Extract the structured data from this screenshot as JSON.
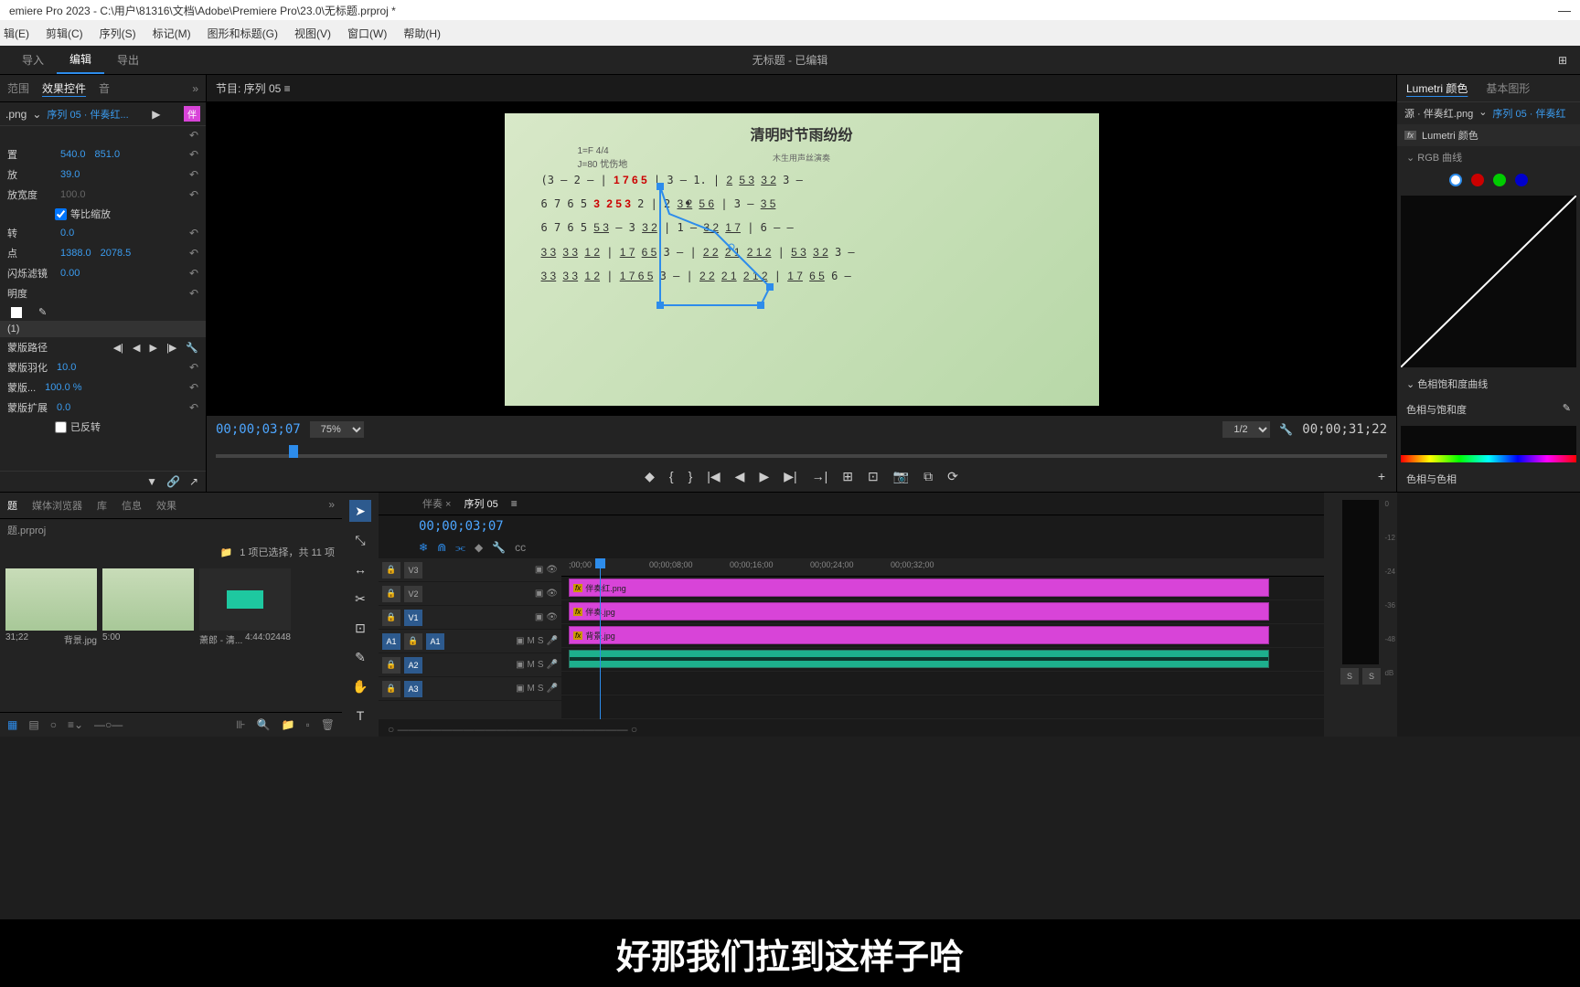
{
  "titlebar": {
    "title": "emiere Pro 2023 - C:\\用户\\81316\\文档\\Adobe\\Premiere Pro\\23.0\\无标题.prproj *"
  },
  "menubar": {
    "items": [
      "辑(E)",
      "剪辑(C)",
      "序列(S)",
      "标记(M)",
      "图形和标题(G)",
      "视图(V)",
      "窗口(W)",
      "帮助(H)"
    ]
  },
  "workspace": {
    "tabs": [
      "导入",
      "编辑",
      "导出"
    ],
    "active": 1,
    "center": "无标题 - 已编辑"
  },
  "effects_panel": {
    "tabs": [
      "范围",
      "效果控件",
      "音"
    ],
    "active": 1,
    "source_label": ".png",
    "sequence_link": "序列 05 · 伴奏红...",
    "badge": "伴",
    "props": {
      "position_label": "置",
      "position_x": "540.0",
      "position_y": "851.0",
      "scale_label": "放",
      "scale": "39.0",
      "scale_w_label": "放宽度",
      "scale_w": "100.0",
      "uniform_label": "等比缩放",
      "rotation_label": "转",
      "rotation": "0.0",
      "anchor_label": "点",
      "anchor_x": "1388.0",
      "anchor_y": "2078.5",
      "flicker_label": "闪烁滤镜",
      "flicker": "0.00",
      "opacity_label": "明度",
      "mask_group": "(1)",
      "mask_path_label": "蒙版路径",
      "mask_feather_label": "蒙版羽化",
      "mask_feather": "10.0",
      "mask_opacity_label": "蒙版...",
      "mask_opacity": "100.0 %",
      "mask_expand_label": "蒙版扩展",
      "mask_expand": "0.0",
      "inverted_label": "已反转"
    }
  },
  "program": {
    "title": "节目: 序列 05 ≡",
    "score_title": "清明时节雨纷纷",
    "score_key": "1=F  4/4",
    "score_tempo": "J=80   忧伤地",
    "score_sub": "木生用声丝演奏",
    "current_time": "00;00;03;07",
    "zoom": "75%",
    "res": "1/2",
    "duration": "00;00;31;22"
  },
  "transport": {
    "icons": [
      "◆",
      "{",
      "}",
      "|◀",
      "◀",
      "▶",
      "▶|",
      "→|",
      "⊞",
      "⊡",
      "📷",
      "⧉",
      "⟳"
    ]
  },
  "lumetri": {
    "tabs": [
      "Lumetri 颜色",
      "基本图形"
    ],
    "active": 0,
    "source": "源 · 伴奏红.png",
    "seq": "序列 05 · 伴奏红",
    "fx_label": "Lumetri 颜色",
    "rgb_label": "RGB 曲线",
    "hsl_title": "色相饱和度曲线",
    "hsl_sub": "色相与饱和度",
    "hsl_sub2": "色相与色相"
  },
  "project": {
    "tabs": [
      "题",
      "媒体浏览器",
      "库",
      "信息",
      "效果"
    ],
    "active": 0,
    "name": "题.prproj",
    "selection": "1 项已选择，共 11 项",
    "bins": [
      {
        "dur": "31;22",
        "name": "背景.jpg"
      },
      {
        "dur": "5:00",
        "name": ""
      },
      {
        "dur": "4:44:02448",
        "name": "萧郎 - 清..."
      }
    ]
  },
  "tools": [
    "▲",
    "⤡",
    "✂",
    "↔",
    "⊡",
    "✎",
    "✋",
    "T"
  ],
  "timeline": {
    "tabs": [
      "伴奏",
      "序列 05"
    ],
    "active": 1,
    "time": "00;00;03;07",
    "ruler": [
      ";00;00",
      "00;00;08;00",
      "00;00;16;00",
      "00;00;24;00",
      "00;00;32;00"
    ],
    "tracks": {
      "v3": {
        "label": "V3",
        "clip": "伴奏红.png"
      },
      "v2": {
        "label": "V2",
        "clip": "伴奏.jpg"
      },
      "v1": {
        "label": "V1",
        "clip": "背景.jpg"
      },
      "a1": {
        "label": "A1",
        "src": "A1"
      },
      "a2": {
        "label": "A2",
        "src": "A2"
      },
      "a3": {
        "label": "A3",
        "src": "A3"
      }
    }
  },
  "meter": {
    "scale": [
      "0",
      "-12",
      "-24",
      "-36",
      "-48",
      "dB"
    ],
    "solo": "S"
  },
  "subtitle": "好那我们拉到这样子哈"
}
